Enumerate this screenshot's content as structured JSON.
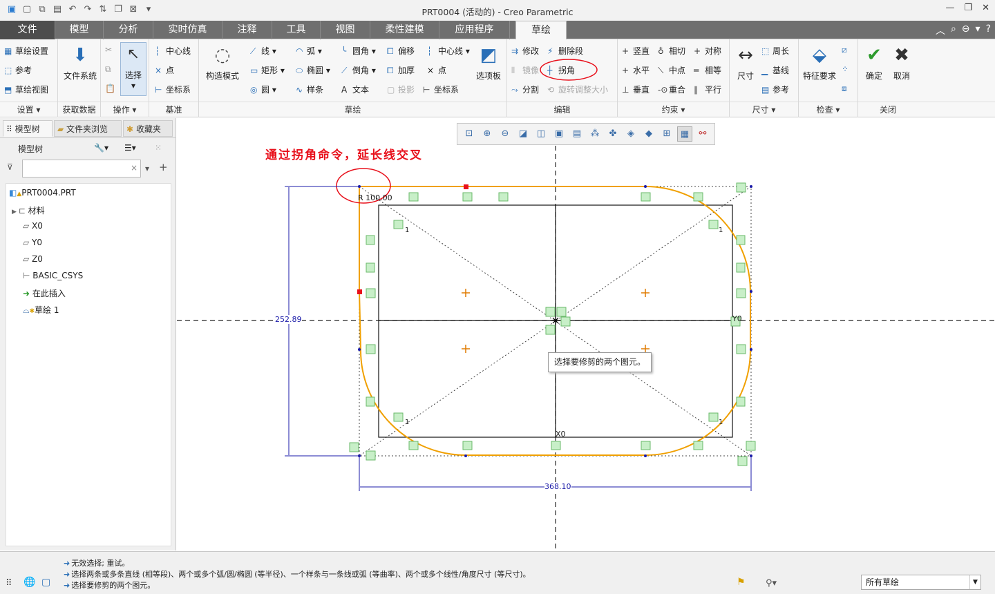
{
  "window": {
    "title": "PRT0004 (活动的) - Creo Parametric"
  },
  "tabs": [
    "文件",
    "模型",
    "分析",
    "实时仿真",
    "注释",
    "工具",
    "视图",
    "柔性建模",
    "应用程序",
    "草绘"
  ],
  "ribbon": {
    "settings": {
      "items": [
        "草绘设置",
        "参考",
        "草绘视图"
      ],
      "label": "设置"
    },
    "get_data": {
      "button": "文件系统",
      "label": "获取数据"
    },
    "operations": {
      "button": "选择",
      "label": "操作"
    },
    "datum": {
      "items": [
        "中心线",
        "点",
        "坐标系"
      ],
      "label": "基准"
    },
    "sketch": {
      "construction": "构造模式",
      "col1": [
        "线",
        "矩形",
        "圆"
      ],
      "col2": [
        "弧",
        "椭圆",
        "样条"
      ],
      "col3": [
        "圆角",
        "倒角",
        "文本"
      ],
      "col4": [
        "偏移",
        "加厚",
        "投影"
      ],
      "col5": [
        "中心线",
        "点",
        "坐标系"
      ],
      "palette": "选项板",
      "label": "草绘"
    },
    "edit": {
      "col1": [
        "修改",
        "镜像",
        "分割"
      ],
      "col2": [
        "删除段",
        "拐角",
        "旋转调整大小"
      ],
      "label": "编辑"
    },
    "constrain": {
      "col1": [
        "竖直",
        "水平",
        "垂直"
      ],
      "col2": [
        "相切",
        "中点",
        "重合"
      ],
      "col3": [
        "对称",
        "相等",
        "平行"
      ],
      "label": "约束"
    },
    "dimension": {
      "button": "尺寸",
      "items": [
        "周长",
        "基线",
        "参考"
      ],
      "label": "尺寸"
    },
    "inspect": {
      "button": "特征要求",
      "label": "检查"
    },
    "close": {
      "ok": "确定",
      "cancel": "取消",
      "label": "关闭"
    }
  },
  "left_panel": {
    "tabs": [
      "模型树",
      "文件夹浏览",
      "收藏夹"
    ],
    "header": "模型树",
    "filter_value": "",
    "tree": [
      "PRT0004.PRT",
      "材料",
      "X0",
      "Y0",
      "Z0",
      "BASIC_CSYS",
      "在此插入",
      "草绘 1"
    ]
  },
  "canvas": {
    "annotation": "通过拐角命令，延长线交叉",
    "radius_label": "R 100.00",
    "height_dim": "252.89",
    "width_dim": "368.10",
    "tooltip": "选择要修剪的两个图元。",
    "axis_y": "Y0",
    "axis_x": "X0"
  },
  "status": {
    "messages": [
      "无效选择; 重试。",
      "选择两条或多条直线 (相等段)、两个或多个弧/圆/椭圆 (等半径)、一个样条与一条线或弧 (等曲率)、两个或多个线性/角度尺寸 (等尺寸)。",
      "选择要修剪的两个图元。"
    ],
    "filter": "所有草绘"
  },
  "colors": {
    "sketch_orange": "#f0a000",
    "annotation_red": "#e8101b",
    "dim_blue": "#1a1aa8"
  }
}
